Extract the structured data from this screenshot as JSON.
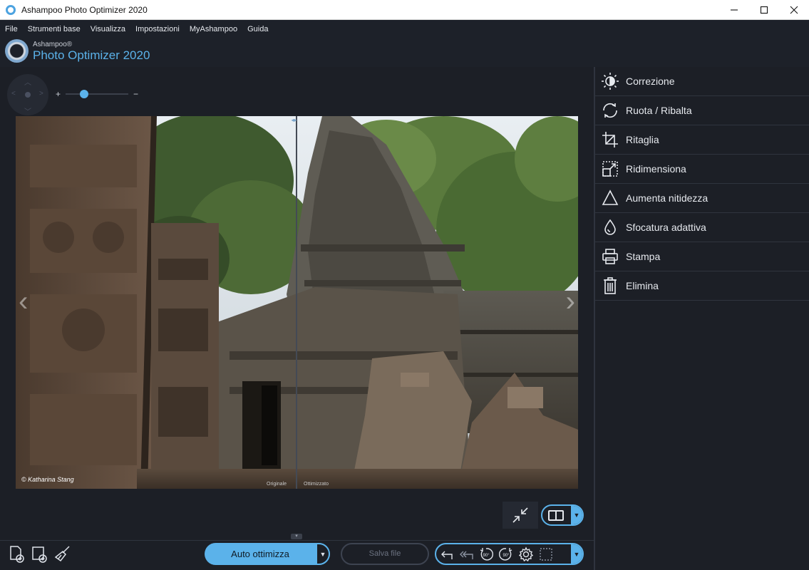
{
  "window": {
    "title": "Ashampoo Photo Optimizer 2020"
  },
  "menu": [
    "File",
    "Strumenti base",
    "Visualizza",
    "Impostazioni",
    "MyAshampoo",
    "Guida"
  ],
  "brand": {
    "small": "Ashampoo®",
    "big": "Photo Optimizer 2020",
    "accent": "#5bb2ea"
  },
  "zoom": {
    "plus": "+",
    "minus": "−",
    "level": 0.3
  },
  "photo": {
    "credit": "© Katharina Stang",
    "label_original": "Originale",
    "label_optimized": "Ottimizzato",
    "split_position": 0.5
  },
  "panel": {
    "items": [
      {
        "label": "Correzione",
        "icon": "brightness-icon"
      },
      {
        "label": "Ruota / Ribalta",
        "icon": "rotate-icon"
      },
      {
        "label": "Ritaglia",
        "icon": "crop-icon"
      },
      {
        "label": "Ridimensiona",
        "icon": "resize-icon"
      },
      {
        "label": "Aumenta nitidezza",
        "icon": "sharpen-icon"
      },
      {
        "label": "Sfocatura adattiva",
        "icon": "blur-drop-icon"
      },
      {
        "label": "Stampa",
        "icon": "print-icon"
      },
      {
        "label": "Elimina",
        "icon": "trash-icon"
      }
    ]
  },
  "toolbar": {
    "auto_label": "Auto ottimizza",
    "save_label": "Salva file",
    "rotate_left_deg": "90°",
    "rotate_right_deg": "90°"
  }
}
